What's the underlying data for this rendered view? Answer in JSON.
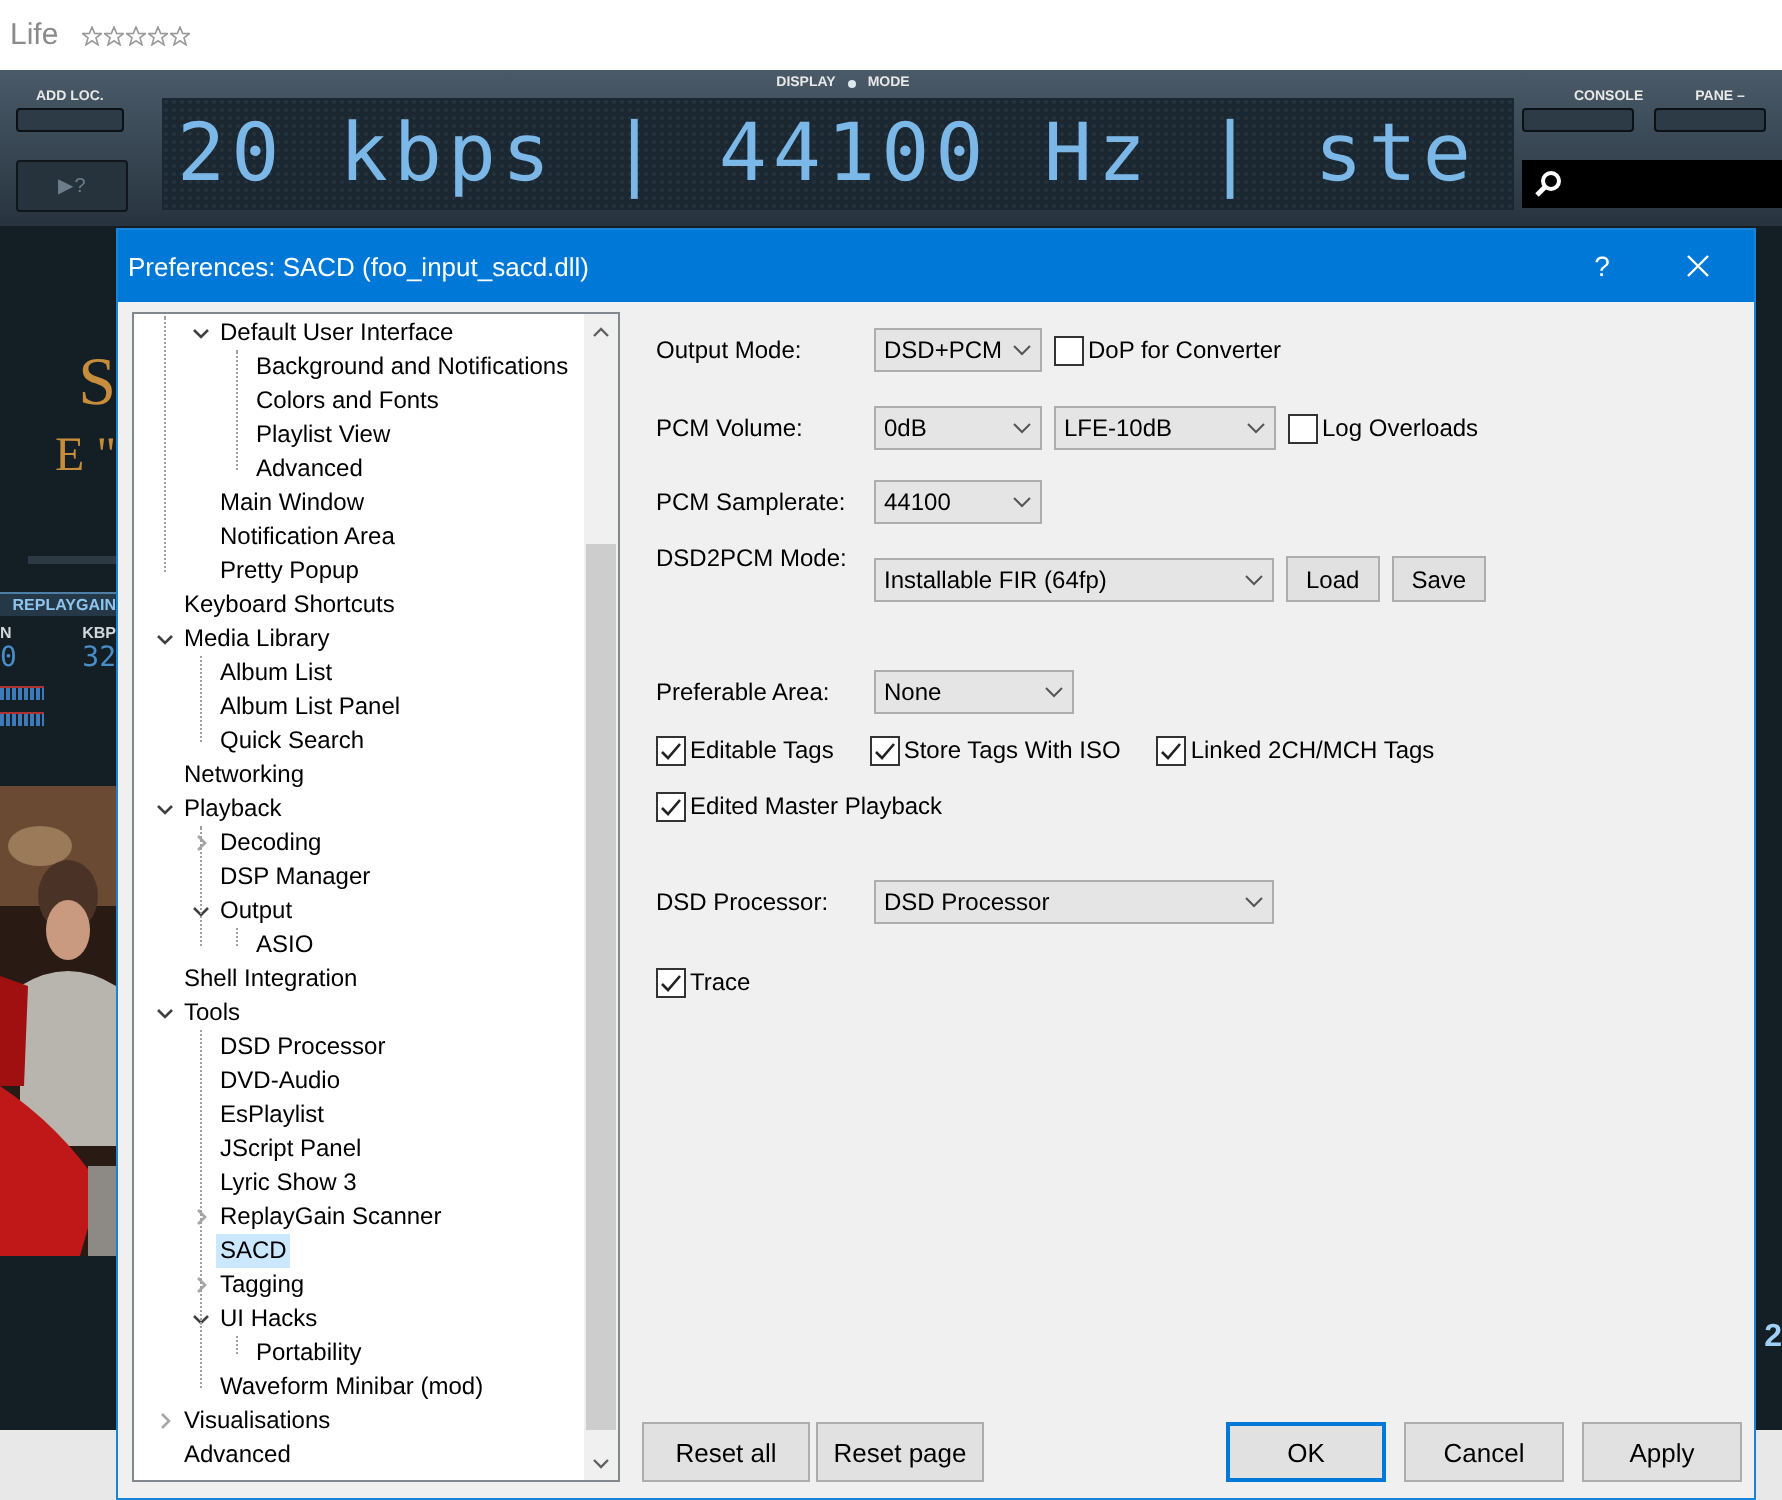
{
  "header": {
    "title": "Life",
    "stars": 0
  },
  "player": {
    "add_location_label": "ADD LOC.",
    "help_button": "▶?",
    "display_label": "DISPLAY",
    "mode_label": "MODE",
    "display_text": "20 kbps | 44100 Hz | ste",
    "console_label": "CONSOLE",
    "pane_label": "PANE –",
    "side_fragments": {
      "title_fragment": "S",
      "subtitle_fragment": "E \"",
      "replaygain_header": "REPLAYGAIN",
      "gain_column": "N",
      "bitrate_column": "KBP",
      "gain_value": "0",
      "bitrate_value": "32",
      "right_fragment": "2"
    }
  },
  "dialog": {
    "title": "Preferences: SACD (foo_input_sacd.dll)",
    "help": "?",
    "tree": {
      "items": [
        {
          "children": [
            {
              "label": "Default User Interface",
              "expanded": true,
              "selected": false,
              "children": [
                {
                  "label": "Background and Notifications",
                  "selected": false
                },
                {
                  "label": "Colors and Fonts",
                  "selected": false
                },
                {
                  "label": "Playlist View",
                  "selected": false
                },
                {
                  "label": "Advanced",
                  "selected": false
                }
              ]
            },
            {
              "label": "Main Window",
              "selected": false
            },
            {
              "label": "Notification Area",
              "selected": false
            },
            {
              "label": "Pretty Popup",
              "selected": false
            }
          ]
        },
        {
          "label": "Keyboard Shortcuts",
          "selected": false
        },
        {
          "label": "Media Library",
          "expanded": true,
          "selected": false,
          "children": [
            {
              "label": "Album List",
              "selected": false
            },
            {
              "label": "Album List Panel",
              "selected": false
            },
            {
              "label": "Quick Search",
              "selected": false
            }
          ]
        },
        {
          "label": "Networking",
          "selected": false
        },
        {
          "label": "Playback",
          "expanded": true,
          "selected": false,
          "children": [
            {
              "label": "Decoding",
              "expanded": false,
              "selected": false
            },
            {
              "label": "DSP Manager",
              "selected": false
            },
            {
              "label": "Output",
              "expanded": true,
              "selected": false,
              "children": [
                {
                  "label": "ASIO",
                  "selected": false
                }
              ]
            }
          ]
        },
        {
          "label": "Shell Integration",
          "selected": false
        },
        {
          "label": "Tools",
          "expanded": true,
          "selected": false,
          "children": [
            {
              "label": "DSD Processor",
              "selected": false
            },
            {
              "label": "DVD-Audio",
              "selected": false
            },
            {
              "label": "EsPlaylist",
              "selected": false
            },
            {
              "label": "JScript Panel",
              "selected": false
            },
            {
              "label": "Lyric Show 3",
              "selected": false
            },
            {
              "label": "ReplayGain Scanner",
              "expanded": false,
              "selected": false
            },
            {
              "label": "SACD",
              "selected": true
            },
            {
              "label": "Tagging",
              "expanded": false,
              "selected": false
            },
            {
              "label": "UI Hacks",
              "expanded": true,
              "selected": false,
              "children": [
                {
                  "label": "Portability",
                  "selected": false
                }
              ]
            },
            {
              "label": "Waveform Minibar (mod)",
              "selected": false
            }
          ]
        },
        {
          "label": "Visualisations",
          "expanded": false,
          "selected": false
        },
        {
          "label": "Advanced",
          "selected": false
        }
      ]
    },
    "rows": [
      {
        "label": "Output Mode:",
        "controls": [
          {
            "kind": "combo",
            "value": "DSD+PCM"
          },
          {
            "kind": "checkbox",
            "label": "DoP for Converter",
            "checked": false
          }
        ]
      },
      {
        "label": "PCM Volume:",
        "controls": [
          {
            "kind": "combo",
            "value": "0dB"
          },
          {
            "kind": "combo",
            "value": "LFE-10dB"
          },
          {
            "kind": "checkbox",
            "label": "Log Overloads",
            "checked": false
          }
        ]
      },
      {
        "label": "PCM Samplerate:",
        "controls": [
          {
            "kind": "combo",
            "value": "44100"
          }
        ]
      },
      {
        "label": "DSD2PCM Mode:",
        "controls": [
          {
            "kind": "combo",
            "value": "Installable FIR (64fp)"
          },
          {
            "kind": "button",
            "label": "Load"
          },
          {
            "kind": "button",
            "label": "Save"
          }
        ]
      },
      {
        "label": "Preferable Area:",
        "controls": [
          {
            "kind": "combo",
            "value": "None"
          }
        ]
      },
      {
        "controls": [
          {
            "kind": "checkbox",
            "label": "Editable Tags",
            "checked": true
          },
          {
            "kind": "checkbox",
            "label": "Store Tags With ISO",
            "checked": true
          },
          {
            "kind": "checkbox",
            "label": "Linked 2CH/MCH Tags",
            "checked": true
          }
        ]
      },
      {
        "controls": [
          {
            "kind": "checkbox",
            "label": "Edited Master Playback",
            "checked": true
          }
        ]
      },
      {
        "label": "DSD Processor:",
        "controls": [
          {
            "kind": "combo",
            "value": "DSD Processor"
          }
        ]
      },
      {
        "controls": [
          {
            "kind": "checkbox",
            "label": "Trace",
            "checked": true
          }
        ]
      }
    ],
    "left_buttons": [
      {
        "label": "Reset all",
        "focused": false
      },
      {
        "label": "Reset page",
        "focused": false
      }
    ],
    "right_buttons": [
      {
        "label": "OK",
        "focused": true
      },
      {
        "label": "Cancel",
        "focused": false
      },
      {
        "label": "Apply",
        "focused": false
      }
    ]
  }
}
